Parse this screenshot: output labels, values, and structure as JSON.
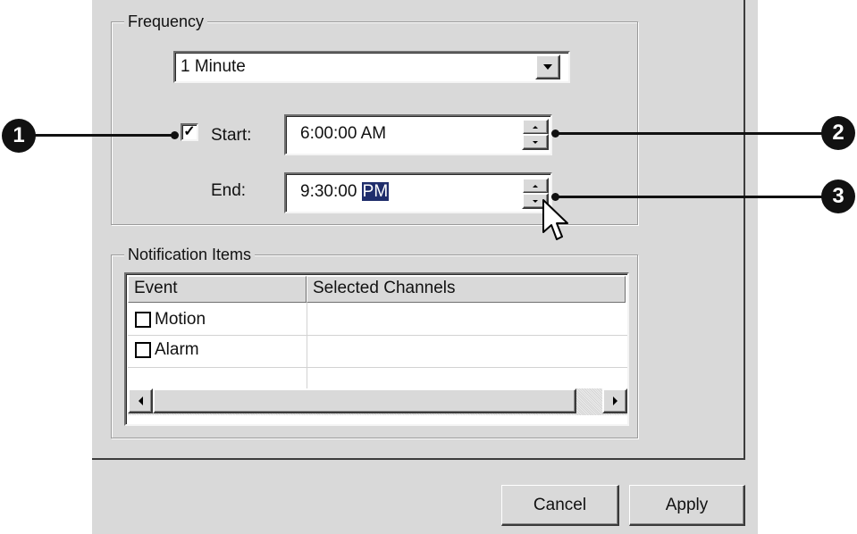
{
  "frequency": {
    "group_label": "Frequency",
    "interval_value": "1 Minute",
    "start_checkbox_checked": true,
    "start_label": "Start:",
    "start_time": "6:00:00 AM",
    "end_label": "End:",
    "end_time_prefix": "9:30:00 ",
    "end_time_selected": "PM"
  },
  "notification": {
    "group_label": "Notification Items",
    "columns": [
      "Event",
      "Selected Channels"
    ],
    "rows": [
      {
        "event": "Motion",
        "checked": false,
        "channels": ""
      },
      {
        "event": "Alarm",
        "checked": false,
        "channels": ""
      }
    ]
  },
  "buttons": {
    "cancel": "Cancel",
    "apply": "Apply"
  },
  "callouts": [
    "1",
    "2",
    "3"
  ],
  "icons": {
    "dropdown": "chevron-down-icon",
    "spin_up": "spin-up-icon",
    "spin_down": "spin-down-icon",
    "scroll_left": "scroll-left-icon",
    "scroll_right": "scroll-right-icon",
    "cursor": "mouse-pointer-icon"
  },
  "colors": {
    "dialog_bg": "#d9d9d9",
    "selection": "#1f2d6b",
    "callout": "#111111"
  }
}
